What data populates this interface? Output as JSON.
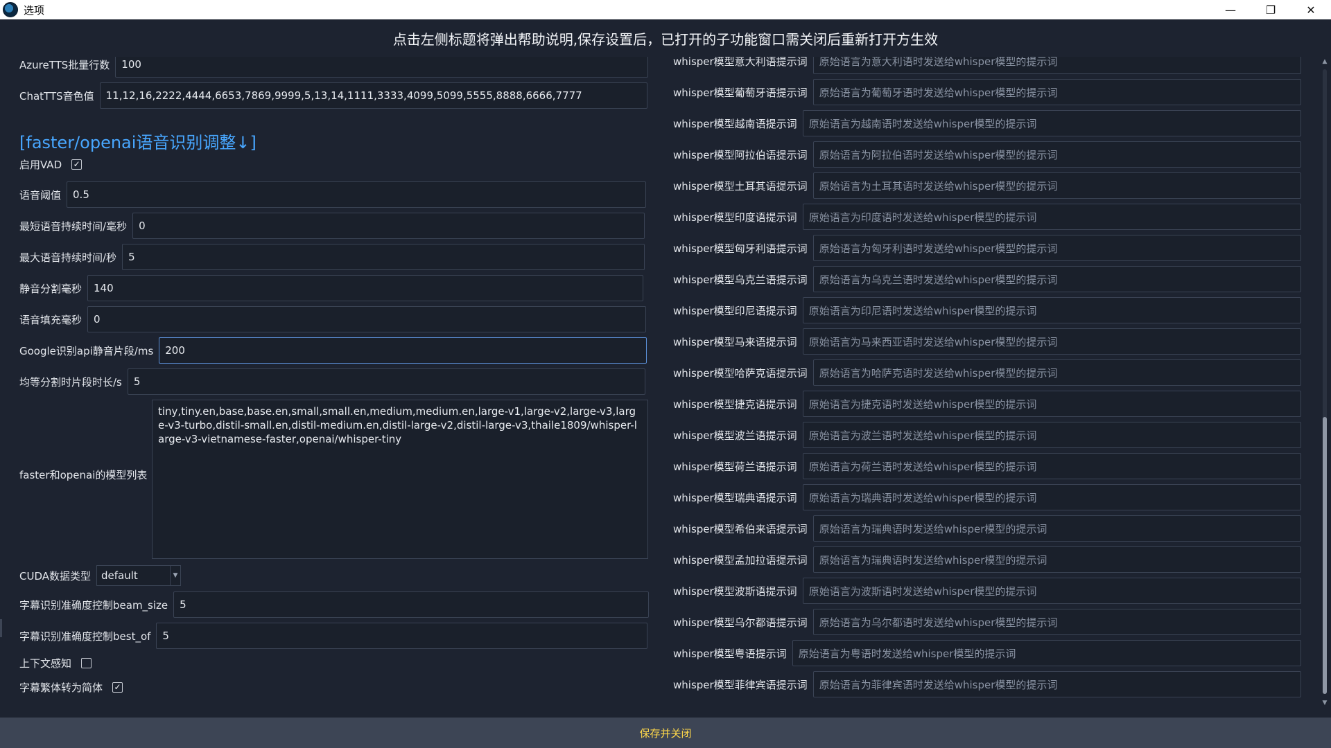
{
  "window": {
    "title": "选项",
    "minimize": "—",
    "maximize": "❐",
    "close": "✕"
  },
  "banner": "点击左侧标题将弹出帮助说明,保存设置后，已打开的子功能窗口需关闭后重新打开方生效",
  "left": {
    "azure_batch": {
      "label": "AzureTTS批量行数",
      "value": "100"
    },
    "chattts_voice": {
      "label": "ChatTTS音色值",
      "value": "11,12,16,2222,4444,6653,7869,9999,5,13,14,1111,3333,4099,5099,5555,8888,6666,7777"
    },
    "section_title": "[faster/openai语音识别调整↓]",
    "vad": {
      "label": "启用VAD",
      "checked": true
    },
    "speech_threshold": {
      "label": "语音阈值",
      "value": "0.5"
    },
    "min_speech": {
      "label": "最短语音持续时间/毫秒",
      "value": "0"
    },
    "max_speech": {
      "label": "最大语音持续时间/秒",
      "value": "5"
    },
    "silence_split": {
      "label": "静音分割毫秒",
      "value": "140"
    },
    "speech_pad": {
      "label": "语音填充毫秒",
      "value": "0"
    },
    "google_silence": {
      "label": "Google识别api静音片段/ms",
      "value": "200"
    },
    "equal_split": {
      "label": "均等分割时片段时长/s",
      "value": "5"
    },
    "model_list": {
      "label": "faster和openai的模型列表",
      "value": "tiny,tiny.en,base,base.en,small,small.en,medium,medium.en,large-v1,large-v2,large-v3,large-v3-turbo,distil-small.en,distil-medium.en,distil-large-v2,distil-large-v3,thaile1809/whisper-large-v3-vietnamese-faster,openai/whisper-tiny"
    },
    "cuda_type": {
      "label": "CUDA数据类型",
      "value": "default"
    },
    "beam_size": {
      "label": "字幕识别准确度控制beam_size",
      "value": "5"
    },
    "best_of": {
      "label": "字幕识别准确度控制best_of",
      "value": "5"
    },
    "context_aware": {
      "label": "上下文感知",
      "checked": false
    },
    "trad_to_simp": {
      "label": "字幕繁体转为简体",
      "checked": true
    }
  },
  "right": [
    {
      "label": "whisper模型意大利语提示词",
      "placeholder": "原始语言为意大利语时发送给whisper模型的提示词"
    },
    {
      "label": "whisper模型葡萄牙语提示词",
      "placeholder": "原始语言为葡萄牙语时发送给whisper模型的提示词"
    },
    {
      "label": "whisper模型越南语提示词",
      "placeholder": "原始语言为越南语时发送给whisper模型的提示词"
    },
    {
      "label": "whisper模型阿拉伯语提示词",
      "placeholder": "原始语言为阿拉伯语时发送给whisper模型的提示词"
    },
    {
      "label": "whisper模型土耳其语提示词",
      "placeholder": "原始语言为土耳其语时发送给whisper模型的提示词"
    },
    {
      "label": "whisper模型印度语提示词",
      "placeholder": "原始语言为印度语时发送给whisper模型的提示词"
    },
    {
      "label": "whisper模型匈牙利语提示词",
      "placeholder": "原始语言为匈牙利语时发送给whisper模型的提示词"
    },
    {
      "label": "whisper模型乌克兰语提示词",
      "placeholder": "原始语言为乌克兰语时发送给whisper模型的提示词"
    },
    {
      "label": "whisper模型印尼语提示词",
      "placeholder": "原始语言为印尼语时发送给whisper模型的提示词"
    },
    {
      "label": "whisper模型马来语提示词",
      "placeholder": "原始语言为马来西亚语时发送给whisper模型的提示词"
    },
    {
      "label": "whisper模型哈萨克语提示词",
      "placeholder": "原始语言为哈萨克语时发送给whisper模型的提示词"
    },
    {
      "label": "whisper模型捷克语提示词",
      "placeholder": "原始语言为捷克语时发送给whisper模型的提示词"
    },
    {
      "label": "whisper模型波兰语提示词",
      "placeholder": "原始语言为波兰语时发送给whisper模型的提示词"
    },
    {
      "label": "whisper模型荷兰语提示词",
      "placeholder": "原始语言为荷兰语时发送给whisper模型的提示词"
    },
    {
      "label": "whisper模型瑞典语提示词",
      "placeholder": "原始语言为瑞典语时发送给whisper模型的提示词"
    },
    {
      "label": "whisper模型希伯来语提示词",
      "placeholder": "原始语言为瑞典语时发送给whisper模型的提示词"
    },
    {
      "label": "whisper模型孟加拉语提示词",
      "placeholder": "原始语言为瑞典语时发送给whisper模型的提示词"
    },
    {
      "label": "whisper模型波斯语提示词",
      "placeholder": "原始语言为波斯语时发送给whisper模型的提示词"
    },
    {
      "label": "whisper模型乌尔都语提示词",
      "placeholder": "原始语言为乌尔都语时发送给whisper模型的提示词"
    },
    {
      "label": "whisper模型粤语提示词",
      "placeholder": "原始语言为粤语时发送给whisper模型的提示词"
    },
    {
      "label": "whisper模型菲律宾语提示词",
      "placeholder": "原始语言为菲律宾语时发送给whisper模型的提示词"
    }
  ],
  "footer": {
    "save_label": "保存并关闭"
  },
  "colors": {
    "background": "#1d2330",
    "accent": "#48a7ff",
    "footer_text": "#ffd84a"
  }
}
